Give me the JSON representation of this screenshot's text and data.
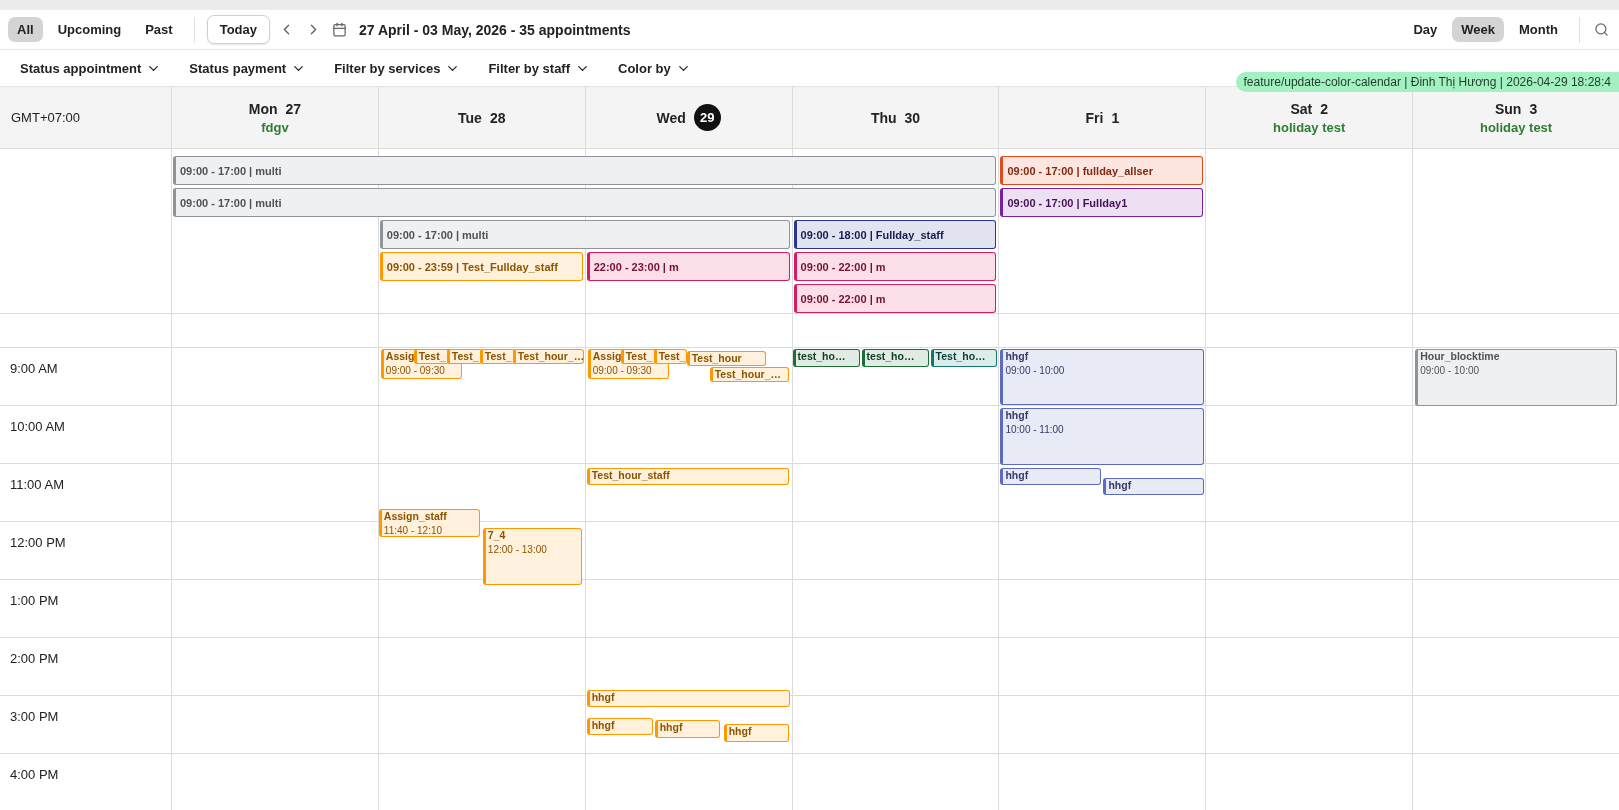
{
  "toolbar": {
    "scopes": [
      {
        "label": "All",
        "selected": true
      },
      {
        "label": "Upcoming",
        "selected": false
      },
      {
        "label": "Past",
        "selected": false
      }
    ],
    "today_button": "Today",
    "range": "27 April - 03 May, 2026 - 35 appointments",
    "views": [
      {
        "label": "Day",
        "selected": false
      },
      {
        "label": "Week",
        "selected": true
      },
      {
        "label": "Month",
        "selected": false
      }
    ]
  },
  "filters": [
    "Status appointment",
    "Status payment",
    "Filter by services",
    "Filter by staff",
    "Color by"
  ],
  "branch_badge": "feature/update-color-calendar | Đinh Thị Hương | 2026-04-29 18:28:4",
  "timezone": "GMT+07:00",
  "days": [
    {
      "name": "Mon",
      "date": "27",
      "today": false,
      "note": "fdgv"
    },
    {
      "name": "Tue",
      "date": "28",
      "today": false,
      "events": [
        {
          "title": "Assig",
          "time": "09:00 - 09:30",
          "color": "#ff9800"
        },
        {
          "title": "Test_",
          "color": "#ff9800"
        },
        {
          "title": "Test_",
          "color": "#ff9800"
        },
        {
          "title": "Test_",
          "color": "#ff9800"
        },
        {
          "title": "Test_hour_…",
          "color": "#ff9800"
        },
        {
          "title": "Assign_staff",
          "time": "11:40 - 12:10",
          "color": "#ff9800"
        },
        {
          "title": "7_4",
          "time": "12:00 - 13:00",
          "color": "#ff9800"
        }
      ]
    },
    {
      "name": "Wed",
      "date": "29",
      "today": true,
      "events": [
        {
          "title": "Assig",
          "time": "09:00 - 09:30",
          "color": "#ff9800"
        },
        {
          "title": "Test_",
          "color": "#ff9800"
        },
        {
          "title": "Test_",
          "color": "#ff9800"
        },
        {
          "title": "Test_hour",
          "color": "#ff9800"
        },
        {
          "title": "Test_hour_…",
          "color": "#ff9800"
        },
        {
          "title": "Test_hour_staff",
          "color": "#ff9800"
        },
        {
          "title": "hhgf",
          "color": "#ff9800"
        },
        {
          "title": "hhgf",
          "color": "#ff9800"
        },
        {
          "title": "hhgf",
          "color": "#ff9800"
        },
        {
          "title": "hhgf",
          "color": "#ff9800"
        }
      ]
    },
    {
      "name": "Thu",
      "date": "30",
      "today": false,
      "events": [
        {
          "title": "test_ho…",
          "color": "#1b6e35"
        },
        {
          "title": "test_ho…",
          "color": "#1b6e35"
        },
        {
          "title": "Test_ho…",
          "color": "#0f7868"
        }
      ]
    },
    {
      "name": "Fri",
      "date": "1",
      "today": false,
      "events": [
        {
          "title": "hhgf",
          "time": "09:00 - 10:00",
          "color": "#5c6bc0"
        },
        {
          "title": "hhgf",
          "time": "10:00 - 11:00",
          "color": "#5c6bc0"
        },
        {
          "title": "hhgf",
          "color": "#5c6bc0"
        },
        {
          "title": "hhgf",
          "color": "#5c6bc0"
        }
      ]
    },
    {
      "name": "Sat",
      "date": "2",
      "today": false,
      "note": "holiday test"
    },
    {
      "name": "Sun",
      "date": "3",
      "today": false,
      "note": "holiday test",
      "events": [
        {
          "title": "Hour_blocktime",
          "time": "09:00 - 10:00",
          "color": "#8f939a"
        }
      ]
    }
  ],
  "all_day_events": [
    {
      "label": "09:00 - 17:00 | multi",
      "color": "#8f939a"
    },
    {
      "label": "09:00 - 17:00 | fullday_allser",
      "color": "#e64a19"
    },
    {
      "label": "09:00 - 17:00 | multi",
      "color": "#8f939a"
    },
    {
      "label": "09:00 - 17:00 | Fullday1",
      "color": "#7b1fa2"
    },
    {
      "label": "09:00 - 17:00 | multi",
      "color": "#8f939a"
    },
    {
      "label": "09:00 - 18:00 | Fullday_staff",
      "color": "#283593"
    },
    {
      "label": "09:00 - 23:59 | Test_Fullday_staff",
      "color": "#ff9800"
    },
    {
      "label": "22:00 - 23:00 | m",
      "color": "#d81b60"
    },
    {
      "label": "09:00 - 22:00 | m",
      "color": "#d81b60"
    },
    {
      "label": "09:00 - 22:00 | m",
      "color": "#d81b60"
    }
  ],
  "hours": [
    "9:00 AM",
    "10:00 AM",
    "11:00 AM",
    "12:00 PM",
    "1:00 PM",
    "2:00 PM",
    "3:00 PM",
    "4:00 PM"
  ]
}
